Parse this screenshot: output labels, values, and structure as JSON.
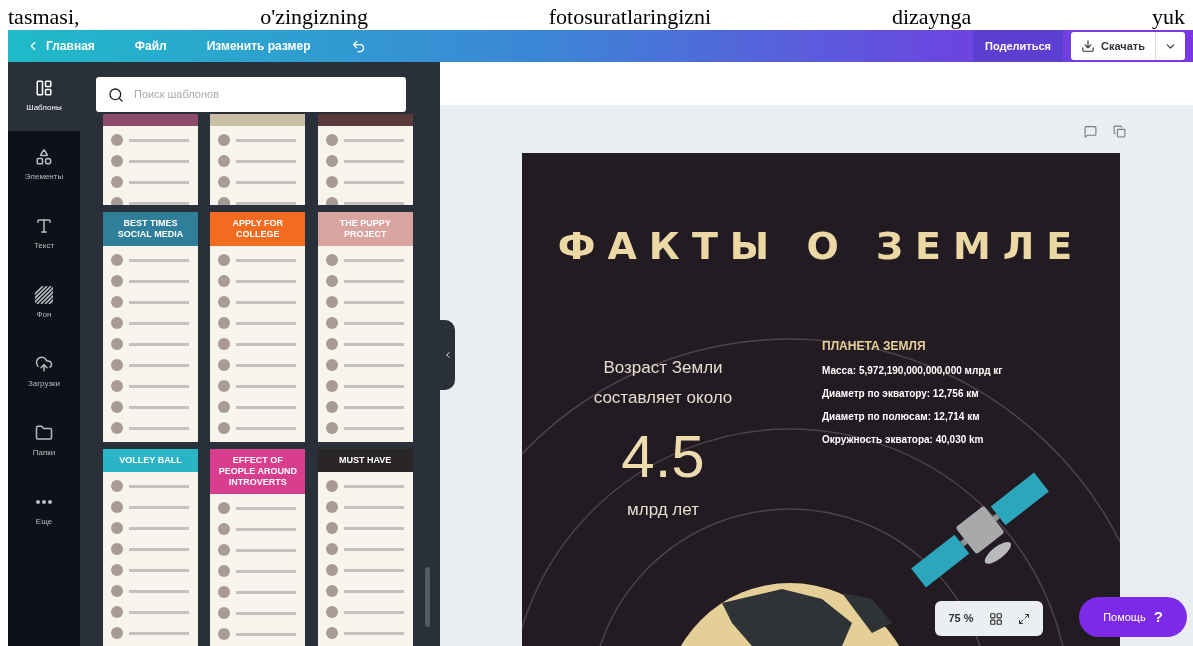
{
  "document_text": [
    "tasmasi,",
    "o'zingizning",
    "fotosuratlaringizni",
    "dizaynga",
    "yuk"
  ],
  "toolbar": {
    "back": "Главная",
    "menu": [
      "Файл",
      "Изменить размер"
    ],
    "share": "Поделиться",
    "download": "Скачать"
  },
  "sidebar": {
    "items": [
      {
        "kind": "templates",
        "label": "Шаблоны",
        "selected": true
      },
      {
        "kind": "elements",
        "label": "Элементы",
        "selected": false
      },
      {
        "kind": "text",
        "label": "Текст",
        "selected": false
      },
      {
        "kind": "background",
        "label": "Фон",
        "selected": false
      },
      {
        "kind": "uploads",
        "label": "Загрузки",
        "selected": false
      },
      {
        "kind": "folders",
        "label": "Папки",
        "selected": false
      },
      {
        "kind": "more",
        "label": "Еще",
        "selected": false
      }
    ]
  },
  "templates": {
    "search": {
      "placeholder": "Поиск шаблонов"
    },
    "items": [
      {
        "color": "#8d4a6a"
      },
      {
        "color": "#c9bfa4"
      },
      {
        "color": "#5a3a3a"
      },
      {
        "title": "BEST TIMES SOCIAL MEDIA",
        "color": "#2f7f9a"
      },
      {
        "title": "APPLY FOR COLLEGE",
        "color": "#f26b21"
      },
      {
        "title": "THE PUPPY PROJECT",
        "color": "#d9a3a0"
      },
      {
        "title": "VOLLEY BALL",
        "color": "#2bb5c4"
      },
      {
        "title": "EFFECT OF PEOPLE AROUND INTROVERTS",
        "color": "#d93e8e"
      },
      {
        "title": "MUST HAVE",
        "color": "#2a2527"
      }
    ]
  },
  "design": {
    "title": "ФАКТЫ О ЗЕМЛЕ",
    "age_caption": "Возраст Земли составляет около",
    "age_value": "4.5",
    "age_unit": "млрд лет",
    "facts_heading": "ПЛАНЕТА ЗЕМЛЯ",
    "facts": [
      "Масса: 5,972,190,000,000,000 млрд кг",
      "Диаметр по экватору: 12,756 км",
      "Диаметр по полюсам: 12,714 км",
      "Окружность экватора: 40,030 km"
    ]
  },
  "zoom": "75 %",
  "help": {
    "label": "Помощь",
    "mark": "?"
  }
}
